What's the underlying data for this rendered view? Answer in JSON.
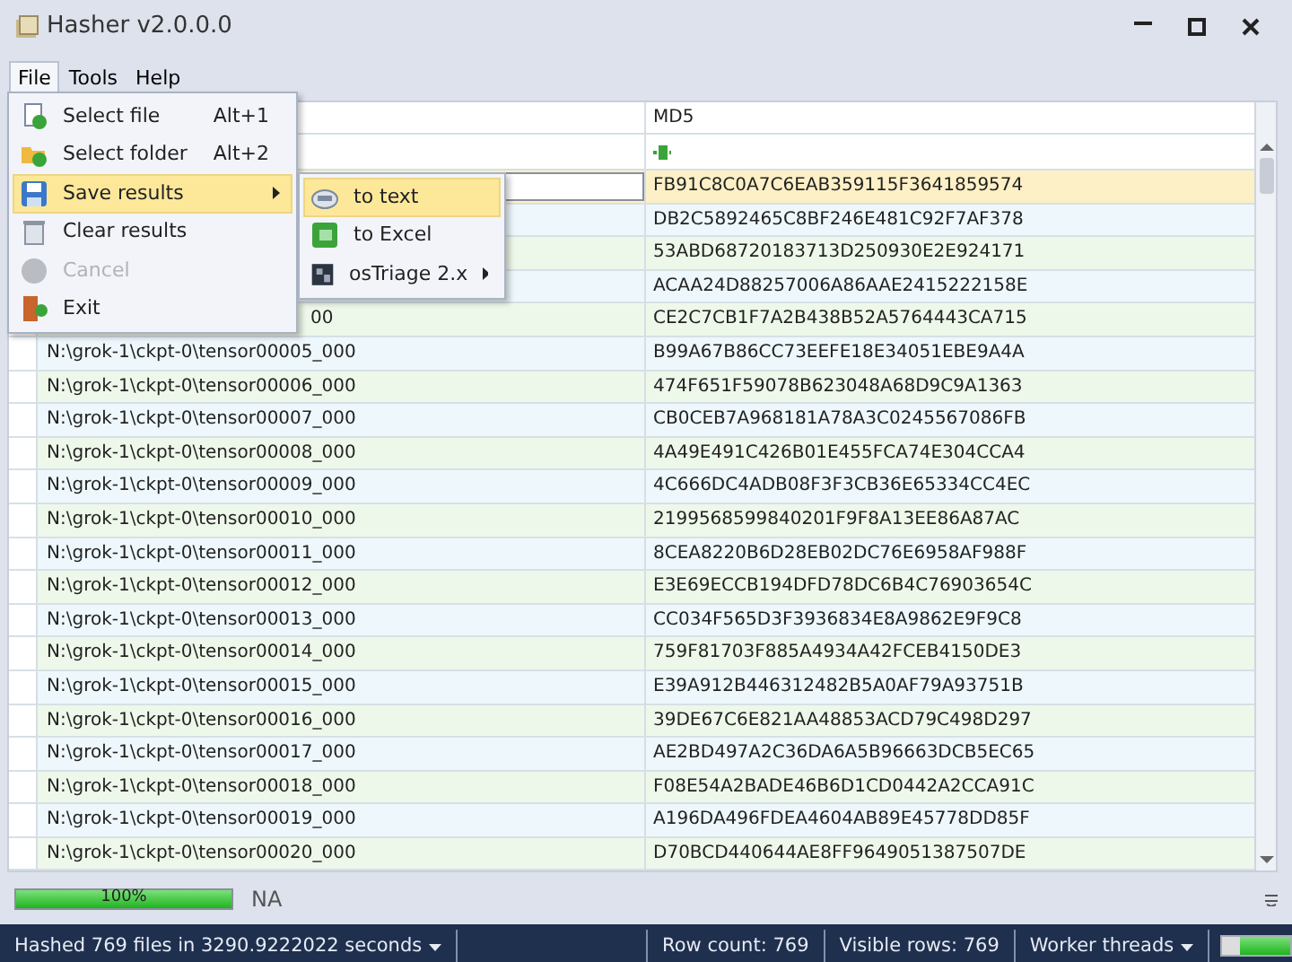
{
  "window": {
    "title": "Hasher v2.0.0.0"
  },
  "menu_bar": [
    {
      "label": "File",
      "selected": true
    },
    {
      "label": "Tools",
      "selected": false
    },
    {
      "label": "Help",
      "selected": false
    }
  ],
  "file_menu": [
    {
      "label": "Select file",
      "shortcut": "Alt+1",
      "selected": false,
      "disabled": false,
      "submenu": false
    },
    {
      "label": "Select folder",
      "shortcut": "Alt+2",
      "selected": false,
      "disabled": false,
      "submenu": false
    },
    {
      "label": "Save results",
      "selected": true,
      "disabled": false,
      "submenu": true
    },
    {
      "label": "Clear results",
      "selected": false,
      "disabled": false,
      "submenu": false
    },
    {
      "label": "Cancel",
      "selected": false,
      "disabled": true,
      "submenu": false
    },
    {
      "label": "Exit",
      "selected": false,
      "disabled": false,
      "submenu": false
    }
  ],
  "save_submenu": [
    {
      "label": "to text",
      "selected": true,
      "submenu": false
    },
    {
      "label": "to Excel",
      "selected": false,
      "submenu": false
    },
    {
      "label": "osTriage 2.x",
      "selected": false,
      "submenu": true
    }
  ],
  "table": {
    "columns": [
      "MD5"
    ],
    "rows": [
      {
        "path": "",
        "md5": "FB91C8C0A7C6EAB359115F3641859574",
        "selected": true,
        "editing": true
      },
      {
        "path": "",
        "md5": "DB2C5892465C8BF246E481C92F7AF378",
        "selected": false
      },
      {
        "path": "",
        "md5": "53ABD68720183713D250930E2E924171",
        "selected": false
      },
      {
        "path": "",
        "md5": "ACAA24D88257006A86AAE2415222158E",
        "selected": false
      },
      {
        "path": "00",
        "clipped": true,
        "md5": "CE2C7CB1F7A2B438B52A5764443CA715",
        "selected": false
      },
      {
        "path": "N:\\grok-1\\ckpt-0\\tensor00005_000",
        "md5": "B99A67B86CC73EEFE18E34051EBE9A4A",
        "selected": false
      },
      {
        "path": "N:\\grok-1\\ckpt-0\\tensor00006_000",
        "md5": "474F651F59078B623048A68D9C9A1363",
        "selected": false
      },
      {
        "path": "N:\\grok-1\\ckpt-0\\tensor00007_000",
        "md5": "CB0CEB7A968181A78A3C0245567086FB",
        "selected": false
      },
      {
        "path": "N:\\grok-1\\ckpt-0\\tensor00008_000",
        "md5": "4A49E491C426B01E455FCA74E304CCA4",
        "selected": false
      },
      {
        "path": "N:\\grok-1\\ckpt-0\\tensor00009_000",
        "md5": "4C666DC4ADB08F3F3CB36E65334CC4EC",
        "selected": false
      },
      {
        "path": "N:\\grok-1\\ckpt-0\\tensor00010_000",
        "md5": "2199568599840201F9F8A13EE86A87AC",
        "selected": false
      },
      {
        "path": "N:\\grok-1\\ckpt-0\\tensor00011_000",
        "md5": "8CEA8220B6D28EB02DC76E6958AF988F",
        "selected": false
      },
      {
        "path": "N:\\grok-1\\ckpt-0\\tensor00012_000",
        "md5": "E3E69ECCB194DFD78DC6B4C76903654C",
        "selected": false
      },
      {
        "path": "N:\\grok-1\\ckpt-0\\tensor00013_000",
        "md5": "CC034F565D3F3936834E8A9862E9F9C8",
        "selected": false
      },
      {
        "path": "N:\\grok-1\\ckpt-0\\tensor00014_000",
        "md5": "759F81703F885A4934A42FCEB4150DE3",
        "selected": false
      },
      {
        "path": "N:\\grok-1\\ckpt-0\\tensor00015_000",
        "md5": "E39A912B446312482B5A0AF79A93751B",
        "selected": false
      },
      {
        "path": "N:\\grok-1\\ckpt-0\\tensor00016_000",
        "md5": "39DE67C6E821AA48853ACD79C498D297",
        "selected": false
      },
      {
        "path": "N:\\grok-1\\ckpt-0\\tensor00017_000",
        "md5": "AE2BD497A2C36DA6A5B96663DCB5EC65",
        "selected": false
      },
      {
        "path": "N:\\grok-1\\ckpt-0\\tensor00018_000",
        "md5": "F08E54A2BADE46B6D1CD0442A2CCA91C",
        "selected": false
      },
      {
        "path": "N:\\grok-1\\ckpt-0\\tensor00019_000",
        "md5": "A196DA496FDEA4604AB89E45778DD85F",
        "selected": false
      },
      {
        "path": "N:\\grok-1\\ckpt-0\\tensor00020_000",
        "md5": "D70BCD440644AE8FF9649051387507DE",
        "selected": false
      }
    ]
  },
  "progress": {
    "level": 1.0,
    "reading": "100%",
    "label": "NA"
  },
  "status_bar": {
    "summary": "Hashed 769 files in 3290.9222022 seconds",
    "row_count": "Row count: 769",
    "visible_rows": "Visible rows: 769",
    "threads": "Worker threads",
    "level": 0.75
  }
}
